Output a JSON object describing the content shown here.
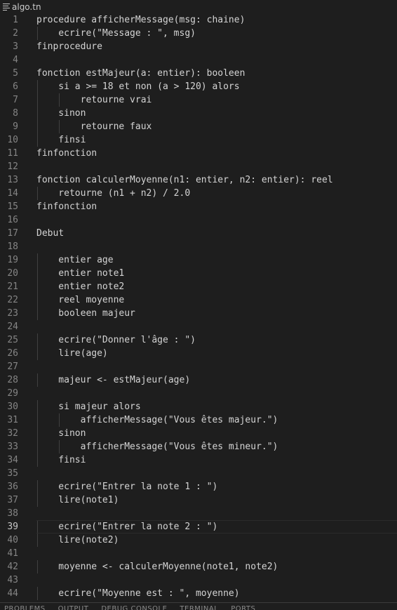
{
  "tab": {
    "icon": "menu-lines-icon",
    "label": "algo.tn"
  },
  "active_line": 39,
  "lines": [
    {
      "n": "1",
      "text": "procedure afficherMessage(msg: chaine)"
    },
    {
      "n": "2",
      "text": "    ecrire(\"Message : \", msg)"
    },
    {
      "n": "3",
      "text": "finprocedure"
    },
    {
      "n": "4",
      "text": ""
    },
    {
      "n": "5",
      "text": "fonction estMajeur(a: entier): booleen"
    },
    {
      "n": "6",
      "text": "    si a >= 18 et non (a > 120) alors"
    },
    {
      "n": "7",
      "text": "        retourne vrai"
    },
    {
      "n": "8",
      "text": "    sinon"
    },
    {
      "n": "9",
      "text": "        retourne faux"
    },
    {
      "n": "10",
      "text": "    finsi"
    },
    {
      "n": "11",
      "text": "finfonction"
    },
    {
      "n": "12",
      "text": ""
    },
    {
      "n": "13",
      "text": "fonction calculerMoyenne(n1: entier, n2: entier): reel"
    },
    {
      "n": "14",
      "text": "    retourne (n1 + n2) / 2.0"
    },
    {
      "n": "15",
      "text": "finfonction"
    },
    {
      "n": "16",
      "text": ""
    },
    {
      "n": "17",
      "text": "Debut"
    },
    {
      "n": "18",
      "text": ""
    },
    {
      "n": "19",
      "text": "    entier age"
    },
    {
      "n": "20",
      "text": "    entier note1"
    },
    {
      "n": "21",
      "text": "    entier note2"
    },
    {
      "n": "22",
      "text": "    reel moyenne"
    },
    {
      "n": "23",
      "text": "    booleen majeur"
    },
    {
      "n": "24",
      "text": ""
    },
    {
      "n": "25",
      "text": "    ecrire(\"Donner l'âge : \")"
    },
    {
      "n": "26",
      "text": "    lire(age)"
    },
    {
      "n": "27",
      "text": ""
    },
    {
      "n": "28",
      "text": "    majeur <- estMajeur(age)"
    },
    {
      "n": "29",
      "text": ""
    },
    {
      "n": "30",
      "text": "    si majeur alors"
    },
    {
      "n": "31",
      "text": "        afficherMessage(\"Vous êtes majeur.\")"
    },
    {
      "n": "32",
      "text": "    sinon"
    },
    {
      "n": "33",
      "text": "        afficherMessage(\"Vous êtes mineur.\")"
    },
    {
      "n": "34",
      "text": "    finsi"
    },
    {
      "n": "35",
      "text": ""
    },
    {
      "n": "36",
      "text": "    ecrire(\"Entrer la note 1 : \")"
    },
    {
      "n": "37",
      "text": "    lire(note1)"
    },
    {
      "n": "38",
      "text": ""
    },
    {
      "n": "39",
      "text": "    ecrire(\"Entrer la note 2 : \")"
    },
    {
      "n": "40",
      "text": "    lire(note2)"
    },
    {
      "n": "41",
      "text": ""
    },
    {
      "n": "42",
      "text": "    moyenne <- calculerMoyenne(note1, note2)"
    },
    {
      "n": "43",
      "text": ""
    },
    {
      "n": "44",
      "text": "    ecrire(\"Moyenne est : \", moyenne)"
    }
  ],
  "panel_tabs": [
    "PROBLEMS",
    "OUTPUT",
    "DEBUG CONSOLE",
    "TERMINAL",
    "PORTS"
  ]
}
